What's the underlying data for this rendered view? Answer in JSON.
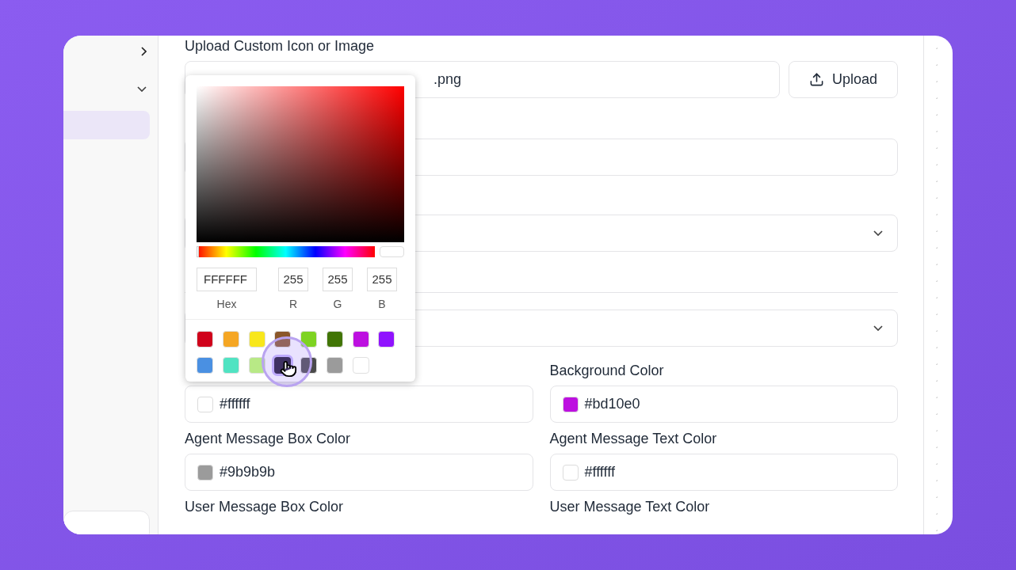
{
  "upload": {
    "label": "Upload Custom Icon or Image",
    "value": ".png",
    "button": "Upload"
  },
  "sidebar": {
    "items": [
      {
        "kind": "collapsed"
      },
      {
        "kind": "expanded"
      },
      {
        "kind": "selected"
      }
    ]
  },
  "selects": [
    {
      "kind": "select"
    },
    {
      "kind": "select"
    }
  ],
  "color_fields": [
    {
      "value": "#ffffff",
      "color": "#ffffff"
    },
    {
      "label": "Background Color",
      "value": "#bd10e0",
      "color": "#bd10e0"
    },
    {
      "label": "Agent Message Box Color",
      "value": "#9b9b9b",
      "color": "#9b9b9b"
    },
    {
      "label": "Agent Message Text Color",
      "value": "#ffffff",
      "color": "#ffffff"
    },
    {
      "label": "User Message Box Color"
    },
    {
      "label": "User Message Text Color"
    }
  ],
  "picker": {
    "hue": {
      "level": 0
    },
    "hex": "FFFFFF",
    "r": "255",
    "g": "255",
    "b": "255",
    "hex_label": "Hex",
    "r_label": "R",
    "g_label": "G",
    "b_label": "B",
    "swatches": [
      {
        "color": "#d0021b",
        "selected": false
      },
      {
        "color": "#f5a623",
        "selected": false
      },
      {
        "color": "#f8e71c",
        "selected": false
      },
      {
        "color": "#8b572a",
        "selected": false
      },
      {
        "color": "#7ed321",
        "selected": false
      },
      {
        "color": "#417505",
        "selected": false
      },
      {
        "color": "#bd10e0",
        "selected": false
      },
      {
        "color": "#9013fe",
        "selected": false
      },
      {
        "color": "#4a90e2",
        "selected": false
      },
      {
        "color": "#50e3c2",
        "selected": false
      },
      {
        "color": "#b8e986",
        "selected": false
      },
      {
        "color": "#1c1330",
        "selected": true
      },
      {
        "color": "#4a4a4a",
        "selected": false
      },
      {
        "color": "#9b9b9b",
        "selected": false
      },
      {
        "color": "#ffffff",
        "selected": false
      }
    ]
  }
}
